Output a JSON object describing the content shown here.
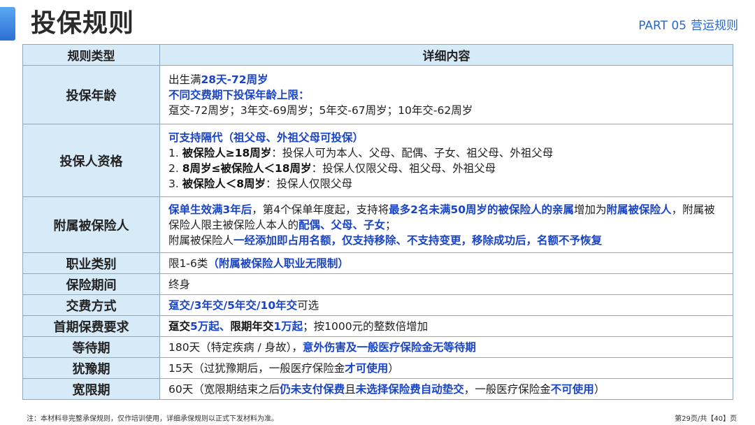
{
  "header": {
    "title": "投保规则",
    "part_label": "PART 05",
    "part_name": "营运规则",
    "accent_color": "#2d6fd6"
  },
  "table": {
    "headers": [
      "规则类型",
      "详细内容"
    ],
    "rows": {
      "age": {
        "label": "投保年龄",
        "l1a": "出生满",
        "l1b": "28天-72周岁",
        "l2": "不同交费期下投保年龄上限：",
        "l3": "趸交-72周岁；3年交-69周岁；5年交-67周岁；10年交-62周岁"
      },
      "holder": {
        "label": "投保人资格",
        "l1": "可支持隔代（祖父母、外祖父母可投保）",
        "l2a": "1. ",
        "l2b": "被保险人≥18周岁",
        "l2c": "：投保人可为本人、父母、配偶、子女、祖父母、外祖父母",
        "l3a": "2. ",
        "l3b": "8周岁≤被保险人＜18周岁",
        "l3c": "：投保人仅限父母、祖父母、外祖父母",
        "l4a": "3. ",
        "l4b": "被保险人＜8周岁",
        "l4c": "：投保人仅限父母"
      },
      "attached": {
        "label": "附属被保险人",
        "p1a": "保单生效满3年后",
        "p1b": "，第4个保单年度起，支持将",
        "p1c": "最多2名未满50周岁的被保险人的亲属",
        "p1d": "增加为",
        "p1e": "附属被保险人",
        "p1f": "，附属被保险人限主被保险人本人的",
        "p1g": "配偶、父母、子女",
        "p1h": "；",
        "p2a": "附属被保险人",
        "p2b": "一经添加即占用名额，仅支持移除、不支持变更，移除成功后，名额不予恢复"
      },
      "occupation": {
        "label": "职业类别",
        "a": "限1-6类",
        "b": "（附属被保险人职业无限制）"
      },
      "period": {
        "label": "保险期间",
        "a": "终身"
      },
      "payment": {
        "label": "交费方式",
        "a": "趸交/3年交/5年交/10年交",
        "b": "可选"
      },
      "premium": {
        "label": "首期保费要求",
        "a": "趸交",
        "b": "5万起",
        "c": "、",
        "d": "限期年交",
        "e": "1万起",
        "f": "；按1000元的整数倍增加"
      },
      "waiting": {
        "label": "等待期",
        "a": "180天（特定疾病 / 身故），",
        "b": "意外伤害及一般医疗保险金无等待期"
      },
      "grace": {
        "label": "犹豫期",
        "a": "15天（过犹豫期后，一般医疗保险金",
        "b": "才可使用",
        "c": "）"
      },
      "extend": {
        "label": "宽限期",
        "a": "60天（宽限期结束之后",
        "b": "仍未支付保费",
        "c": "且",
        "d": "未选择保险费自动垫交",
        "e": "，一般医疗保险金",
        "f": "不可使用",
        "g": "）"
      }
    }
  },
  "footer": {
    "note": "注：本材料非完整承保规则，仅作培训使用，详细承保规则以正式下发材料为准。",
    "page": "第29页/共【40】页"
  }
}
